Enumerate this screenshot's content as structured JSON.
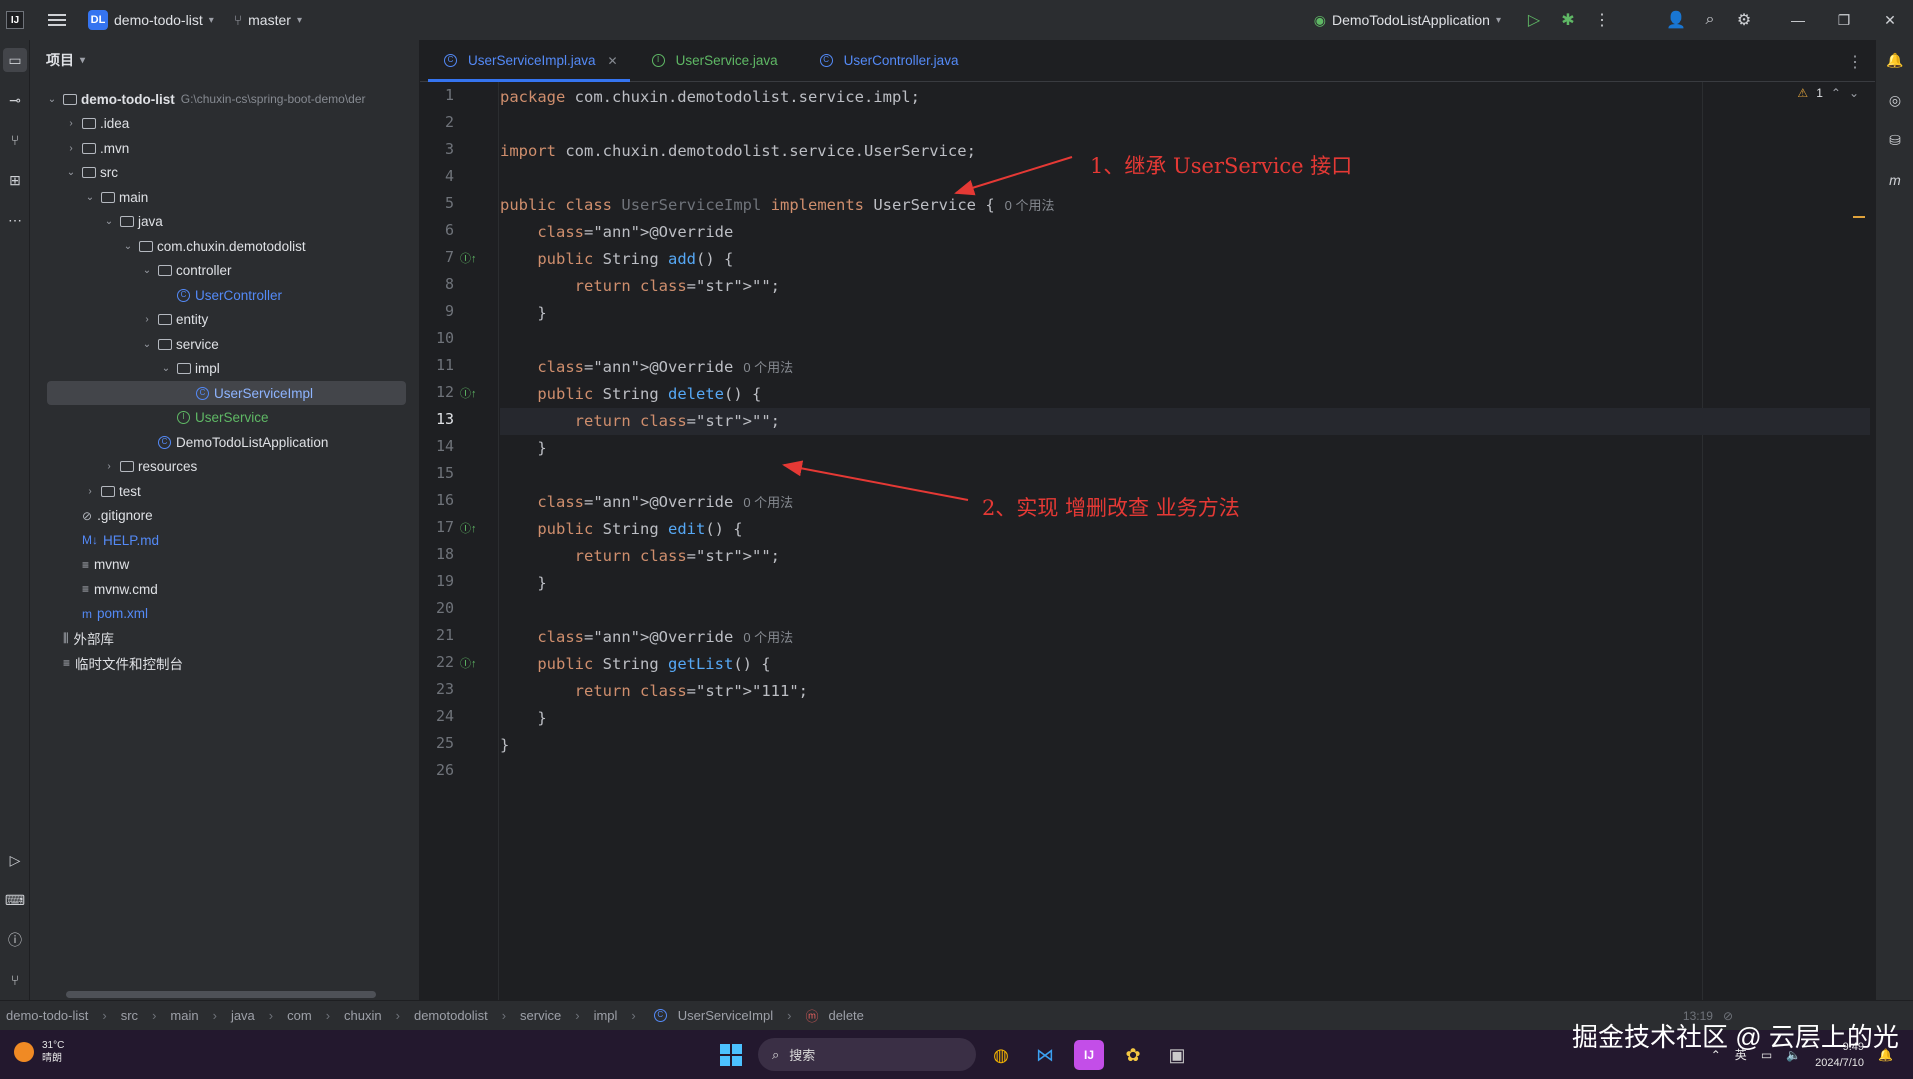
{
  "titlebar": {
    "logo": "IJ",
    "project_badge": "DL",
    "project_name": "demo-todo-list",
    "branch_icon": "branch-icon",
    "branch": "master",
    "run_config": "DemoTodoListApplication",
    "icons": [
      "run-icon",
      "debug-icon",
      "more-icon",
      "add-user-icon",
      "search-icon",
      "settings-icon"
    ],
    "window_controls": [
      "minimize",
      "restore",
      "close"
    ]
  },
  "project_panel": {
    "title": "项目",
    "tree": [
      {
        "label": "demo-todo-list",
        "path": "G:\\chuxin-cs\\spring-boot-demo\\der",
        "kind": "root",
        "expanded": true
      },
      {
        "label": ".idea",
        "kind": "folder",
        "expanded": false
      },
      {
        "label": ".mvn",
        "kind": "folder",
        "expanded": false
      },
      {
        "label": "src",
        "kind": "folder",
        "expanded": true
      },
      {
        "label": "main",
        "kind": "folder",
        "expanded": true
      },
      {
        "label": "java",
        "kind": "folder",
        "expanded": true
      },
      {
        "label": "com.chuxin.demotodolist",
        "kind": "package",
        "expanded": true
      },
      {
        "label": "controller",
        "kind": "package",
        "expanded": true
      },
      {
        "label": "UserController",
        "kind": "class"
      },
      {
        "label": "entity",
        "kind": "package",
        "expanded": false
      },
      {
        "label": "service",
        "kind": "package",
        "expanded": true
      },
      {
        "label": "impl",
        "kind": "package",
        "expanded": true
      },
      {
        "label": "UserServiceImpl",
        "kind": "class",
        "selected": true
      },
      {
        "label": "UserService",
        "kind": "interface"
      },
      {
        "label": "DemoTodoListApplication",
        "kind": "app"
      },
      {
        "label": "resources",
        "kind": "folder",
        "expanded": false
      },
      {
        "label": "test",
        "kind": "folder",
        "expanded": false
      },
      {
        "label": ".gitignore",
        "kind": "file"
      },
      {
        "label": "HELP.md",
        "kind": "md"
      },
      {
        "label": "mvnw",
        "kind": "file"
      },
      {
        "label": "mvnw.cmd",
        "kind": "file"
      },
      {
        "label": "pom.xml",
        "kind": "maven"
      },
      {
        "label": "外部库",
        "kind": "lib"
      },
      {
        "label": "临时文件和控制台",
        "kind": "scratch"
      }
    ]
  },
  "editor": {
    "tabs": [
      {
        "label": "UserServiceImpl.java",
        "active": true,
        "kind": "class"
      },
      {
        "label": "UserService.java",
        "active": false,
        "kind": "interface"
      },
      {
        "label": "UserController.java",
        "active": false,
        "kind": "class"
      }
    ],
    "inspection": {
      "warnings": "1"
    },
    "current_line": 13,
    "lines": [
      {
        "n": "1",
        "code": "package com.chuxin.demotodolist.service.impl;"
      },
      {
        "n": "2",
        "code": ""
      },
      {
        "n": "3",
        "code": "import com.chuxin.demotodolist.service.UserService;"
      },
      {
        "n": "4",
        "code": ""
      },
      {
        "n": "5",
        "code": "public class UserServiceImpl implements UserService {",
        "hint": "0 个用法"
      },
      {
        "n": "6",
        "code": "    @Override"
      },
      {
        "n": "7",
        "code": "    public String add() {"
      },
      {
        "n": "8",
        "code": "        return \"\";"
      },
      {
        "n": "9",
        "code": "    }"
      },
      {
        "n": "10",
        "code": ""
      },
      {
        "n": "11",
        "code": "    @Override",
        "hint": "0 个用法"
      },
      {
        "n": "12",
        "code": "    public String delete() {"
      },
      {
        "n": "13",
        "code": "        return \"\";"
      },
      {
        "n": "14",
        "code": "    }"
      },
      {
        "n": "15",
        "code": ""
      },
      {
        "n": "16",
        "code": "    @Override",
        "hint": "0 个用法"
      },
      {
        "n": "17",
        "code": "    public String edit() {"
      },
      {
        "n": "18",
        "code": "        return \"\";"
      },
      {
        "n": "19",
        "code": "    }"
      },
      {
        "n": "20",
        "code": ""
      },
      {
        "n": "21",
        "code": "    @Override",
        "hint": "0 个用法"
      },
      {
        "n": "22",
        "code": "    public String getList() {"
      },
      {
        "n": "23",
        "code": "        return \"111\";"
      },
      {
        "n": "24",
        "code": "    }"
      },
      {
        "n": "25",
        "code": "}"
      },
      {
        "n": "26",
        "code": ""
      }
    ],
    "annotations": [
      "1、继承 UserService 接口",
      "2、实现 增删改查 业务方法"
    ]
  },
  "statusbar": {
    "breadcrumb": [
      "demo-todo-list",
      "src",
      "main",
      "java",
      "com",
      "chuxin",
      "demotodolist",
      "service",
      "impl",
      "UserServiceImpl",
      "delete"
    ],
    "position": "13:19"
  },
  "taskbar": {
    "weather_temp": "31°C",
    "weather_desc": "晴朗",
    "search_placeholder": "搜索",
    "ime": "英",
    "time": "9:49",
    "date": "2024/7/10",
    "watermark": "掘金技术社区 @ 云层上的光"
  },
  "colors": {
    "accent": "#3574f0",
    "annotation": "#e53935",
    "keyword": "#cf8e6d",
    "annotation_code": "#b3ae60",
    "string": "#6aab73",
    "method": "#56a8f5"
  }
}
